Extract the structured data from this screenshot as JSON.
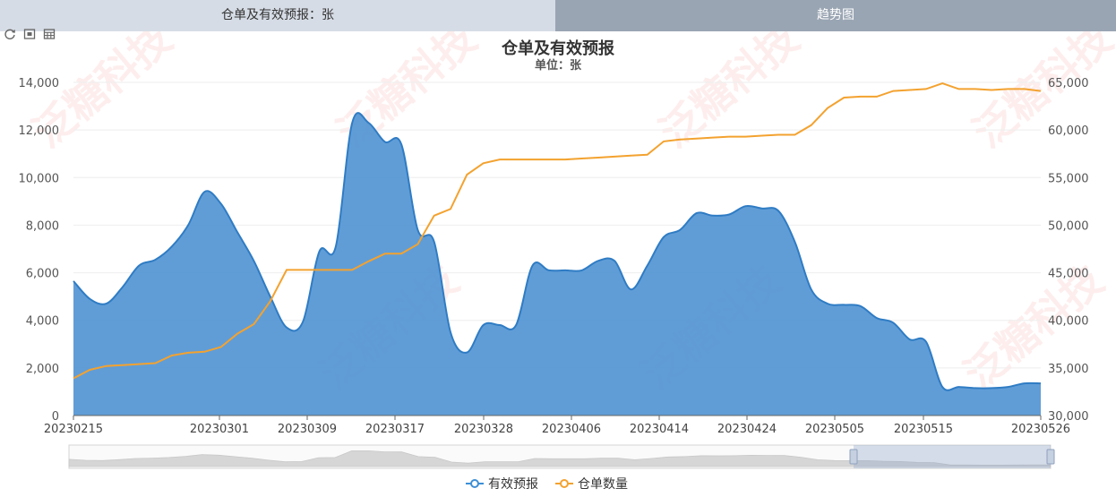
{
  "tabs": {
    "left": "仓单及有效预报：张",
    "right": "趋势图"
  },
  "toolbox": {
    "icons": [
      "refresh-icon",
      "data-zoom-icon",
      "data-view-icon"
    ]
  },
  "watermark": "泛糖科技",
  "colors": {
    "blue": "#3d8fd6",
    "blue_fill": "#4a90d2",
    "orange": "#f3a22f",
    "axis": "#999999"
  },
  "chart_data": {
    "type": "area",
    "title": "仓单及有效预报",
    "subtitle": "单位：张",
    "x_ticks": [
      "20230215",
      "20230301",
      "20230309",
      "20230317",
      "20230328",
      "20230406",
      "20230414",
      "20230424",
      "20230505",
      "20230515",
      "20230526"
    ],
    "y_left": {
      "ticks": [
        "0",
        "2,000",
        "4,000",
        "6,000",
        "8,000",
        "10,000",
        "12,000",
        "14,000"
      ],
      "range": [
        0,
        14000
      ]
    },
    "y_right": {
      "ticks": [
        "30,000",
        "35,000",
        "40,000",
        "45,000",
        "50,000",
        "55,000",
        "60,000",
        "65,000"
      ],
      "range": [
        30000,
        65000
      ]
    },
    "legend": [
      "有效预报",
      "仓单数量"
    ],
    "legend_position": "bottom-center",
    "series": [
      {
        "name": "有效预报",
        "axis": "left",
        "type": "area",
        "values": [
          5650,
          4900,
          4700,
          5400,
          6300,
          6550,
          7100,
          8000,
          9400,
          8900,
          7700,
          6500,
          5000,
          3700,
          3950,
          6900,
          7100,
          12300,
          12300,
          11500,
          11400,
          7800,
          7300,
          3500,
          2650,
          3800,
          3800,
          3800,
          6300,
          6100,
          6100,
          6100,
          6500,
          6500,
          5300,
          6300,
          7500,
          7800,
          8500,
          8400,
          8450,
          8800,
          8700,
          8600,
          7300,
          5300,
          4700,
          4650,
          4600,
          4100,
          3900,
          3200,
          3100,
          1200,
          1200,
          1150,
          1150,
          1200,
          1350,
          1350
        ]
      },
      {
        "name": "仓单数量",
        "axis": "right",
        "type": "line",
        "values": [
          33900,
          34800,
          35200,
          35300,
          35400,
          35500,
          36300,
          36600,
          36700,
          37200,
          38600,
          39600,
          42000,
          45300,
          45300,
          45300,
          45300,
          45300,
          46200,
          47000,
          47000,
          48000,
          51000,
          51700,
          55300,
          56500,
          56900,
          56900,
          56900,
          56900,
          56900,
          57000,
          57100,
          57200,
          57300,
          57400,
          58800,
          59000,
          59100,
          59200,
          59300,
          59300,
          59400,
          59500,
          59500,
          60500,
          62300,
          63400,
          63500,
          63500,
          64100,
          64200,
          64300,
          64900,
          64300,
          64300,
          64200,
          64300,
          64300,
          64100
        ]
      }
    ]
  }
}
